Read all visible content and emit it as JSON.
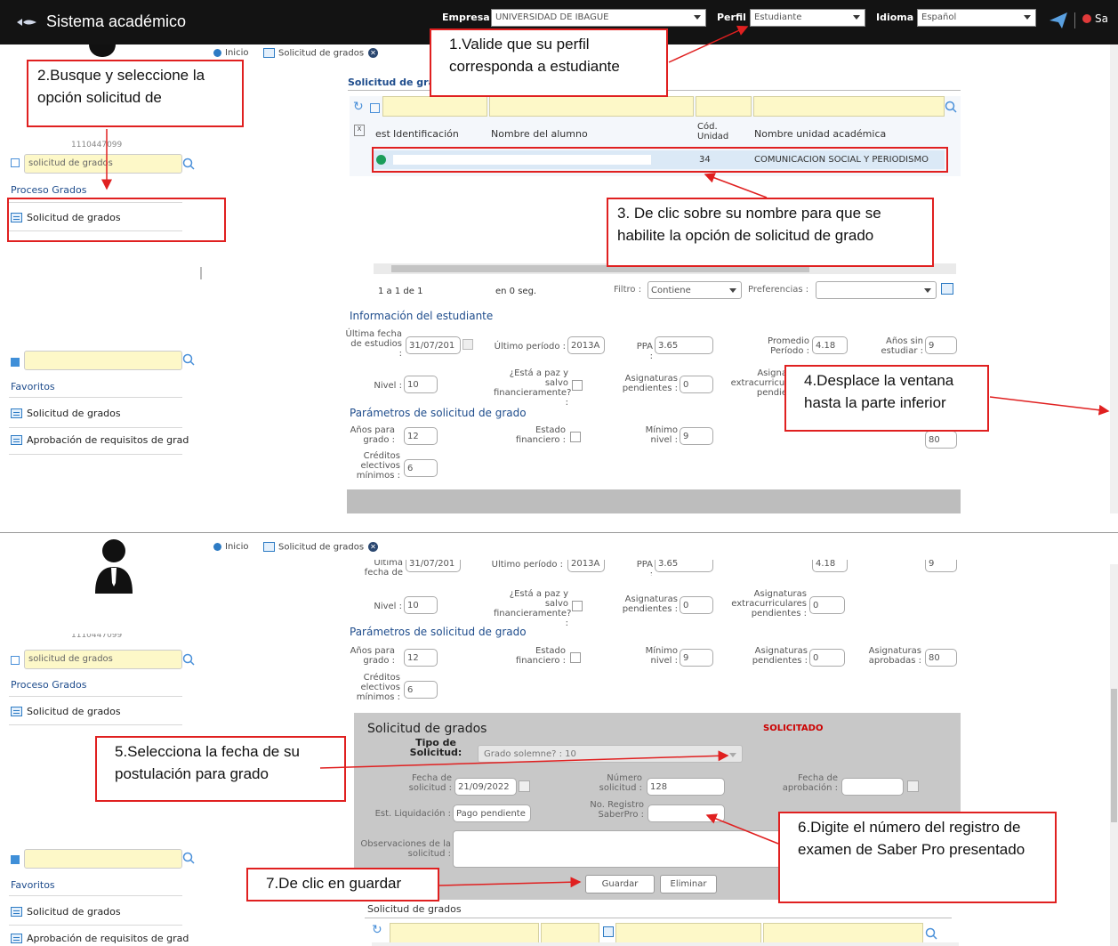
{
  "app": {
    "title": "Sistema académico"
  },
  "topbar": {
    "empresa_label": "Empresa :",
    "empresa_value": "UNIVERSIDAD DE IBAGUE",
    "perfil_label": "Perfil :",
    "perfil_value": "Estudiante",
    "idioma_label": "Idioma :",
    "idioma_value": "Español",
    "exit_label": "Sa"
  },
  "tabs": {
    "home": "Inicio",
    "current": "Solicitud de grados"
  },
  "sidebar": {
    "user_id": "1110447099",
    "search_value": "solicitud de grados",
    "group_title": "Proceso Grados",
    "result_item": "Solicitud de grados",
    "favorites_title": "Favoritos",
    "favorites": [
      "Solicitud de grados",
      "Aprobación de requisitos de grad"
    ]
  },
  "grid": {
    "title": "Solicitud de gra",
    "headers": {
      "est": "est",
      "identificacion": "Identificación",
      "nombre": "Nombre del alumno",
      "cod_unidad": "Cód. Unidad",
      "unidad": "Nombre unidad académica"
    },
    "row": {
      "cod": "34",
      "unidad": "COMUNICACION SOCIAL Y PERIODISMO"
    },
    "pager": "1 a 1 de 1",
    "timing": "en 0 seg.",
    "filter_label": "Filtro :",
    "filter_value": "Contiene",
    "prefs_label": "Preferencias :"
  },
  "student_info": {
    "title": "Información del estudiante",
    "ultima_fecha_label": "Última fecha de estudios :",
    "ultima_fecha": "31/07/201",
    "ultimo_periodo_label": "Último período :",
    "ultimo_periodo": "2013A",
    "ppa_label": "PPA :",
    "ppa": "3.65",
    "promedio_label": "Promedio Período :",
    "promedio": "4.18",
    "anos_sin_label": "Años sin estudiar :",
    "anos_sin": "9",
    "nivel_label": "Nivel :",
    "nivel": "10",
    "paz_salvo_label": "¿Está a paz y salvo financieramente? :",
    "asig_pend_label": "Asignaturas pendientes :",
    "asig_pend": "0",
    "asig_extra_label": "Asignaturas extracurriculares pendientes :",
    "asig_extra": "0",
    "asig_extra_label_p1": "Asigna extracurricul pendie"
  },
  "params": {
    "title": "Parámetros de solicitud de grado",
    "anos_grado_label": "Años para grado :",
    "anos_grado": "12",
    "estado_fin_label": "Estado financiero :",
    "minimo_nivel_label": "Mínimo nivel :",
    "minimo_nivel": "9",
    "asig_pend_label": "Asignaturas pendientes :",
    "asig_pend": "0",
    "asig_aprob_label": "Asignaturas aprobadas :",
    "asig_aprob": "80",
    "creditos_label": "Créditos electivos mínimos :",
    "creditos": "6"
  },
  "request_form": {
    "title": "Solicitud de grados",
    "status": "SOLICITADO",
    "tipo_label": "Tipo de Solicitud:",
    "tipo_value": "Grado solemne? : 10",
    "fecha_sol_label": "Fecha de solicitud :",
    "fecha_sol": "21/09/2022",
    "numero_label": "Número solicitud :",
    "numero": "128",
    "fecha_aprob_label": "Fecha de aprobación :",
    "liquidacion_label": "Est. Liquidación :",
    "liquidacion": "Pago pendiente",
    "saberpro_label": "No. Registro SaberPro :",
    "observaciones_label": "Observaciones de la solicitud :",
    "guardar": "Guardar",
    "eliminar": "Eliminar",
    "subgrid_title": "Solicitud de grados"
  },
  "callouts": {
    "c1": "1.Valide que su perfil corresponda a estudiante",
    "c2": "2.Busque y seleccione la opción solicitud de",
    "c3": "3. De clic sobre su nombre para que se habilite la opción de solicitud de grado",
    "c4": "4.Desplace la ventana hasta la parte inferior",
    "c5": "5.Selecciona la fecha de su postulación para grado",
    "c6": "6.Digite el número del registro de examen de Saber Pro presentado",
    "c7": "7.De clic en guardar"
  },
  "colors": {
    "callout_border": "#e02020",
    "topbar": "#131313",
    "accent": "#1e4c8c",
    "search_bg": "#fdf8c8"
  }
}
